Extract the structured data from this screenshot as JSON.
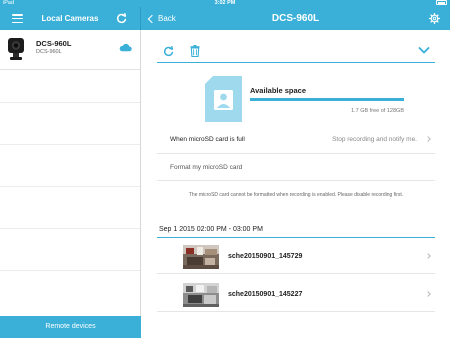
{
  "status_bar": {
    "device": "iPad",
    "time": "3:02 PM"
  },
  "sidebar": {
    "title": "Local Cameras",
    "camera": {
      "name": "DCS-960L",
      "model": "DCS-960L"
    },
    "remote_label": "Remote devices"
  },
  "header": {
    "back_label": "Back",
    "title": "DCS-960L"
  },
  "storage": {
    "title": "Available space",
    "detail": "1.7 GB free of 128GB",
    "used_fraction": 1.0
  },
  "settings": {
    "full_label": "When microSD card is full",
    "full_value": "Stop recording and notify me.",
    "format_label": "Format my microSD card",
    "format_note": "The microSD card cannot be formatted when recording is enabled. Please disable recording first."
  },
  "recordings": {
    "date_header": "Sep 1 2015 02:00 PM - 03:00 PM",
    "items": [
      {
        "name": "sche20150901_145729"
      },
      {
        "name": "sche20150901_145227"
      }
    ]
  },
  "colors": {
    "accent": "#3ab0d8",
    "bar_dark": "#2e9cc2"
  },
  "icons": [
    "menu-icon",
    "refresh-icon",
    "back-chevron-icon",
    "gear-icon",
    "cloud-icon",
    "trash-icon",
    "chevron-down-icon",
    "sd-card-icon",
    "chevron-right-icon"
  ]
}
